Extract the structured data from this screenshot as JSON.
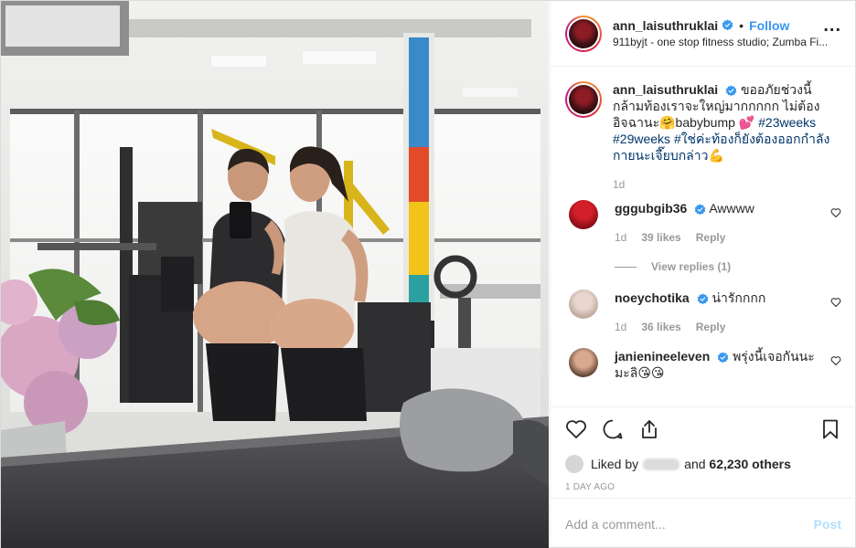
{
  "post": {
    "header": {
      "username": "ann_laisuthruklai",
      "follow_label": "Follow",
      "dot": "•",
      "location": "911byjt - one stop fitness studio; Zumba Fi...",
      "more": "..."
    },
    "caption": {
      "username": "ann_laisuthruklai",
      "text_1": "ขออภัยช่วงนี้กล้ามท้องเราจะใหญ่มากกกกก ไม่ต้องอิจฉานะ🤗babybump 💕",
      "hashtag_1": "#23weeks",
      "hashtag_2": "#29weeks",
      "hashtag_3": "#ใช่ค่ะท้องก็ยังต้องออกกำลังกายนะเจี๊ยบกล่าว",
      "emoji_end": "💪",
      "time": "1d"
    },
    "comments": [
      {
        "username": "gggubgib36",
        "text": "Awwww",
        "time": "1d",
        "likes": "39 likes",
        "reply": "Reply",
        "view_replies": "View replies (1)"
      },
      {
        "username": "noeychotika",
        "text": "น่ารักกกก",
        "time": "1d",
        "likes": "36 likes",
        "reply": "Reply"
      },
      {
        "username": "janienineeleven",
        "text": "พรุ่งนี้เจอกันนะมะลิ😘😘"
      }
    ],
    "likes": {
      "liked_by": "Liked by",
      "and_label": "and",
      "count": "62,230 others"
    },
    "time_ago": "1 DAY AGO",
    "add_comment": {
      "placeholder": "Add a comment...",
      "post_label": "Post"
    }
  },
  "colors": {
    "link": "#3897f0",
    "hashtag": "#003569",
    "muted": "#999999",
    "post_disabled": "#b2dffc"
  },
  "icons": [
    "verified-icon",
    "more-icon",
    "heart-icon",
    "comment-icon",
    "share-icon",
    "bookmark-icon"
  ]
}
